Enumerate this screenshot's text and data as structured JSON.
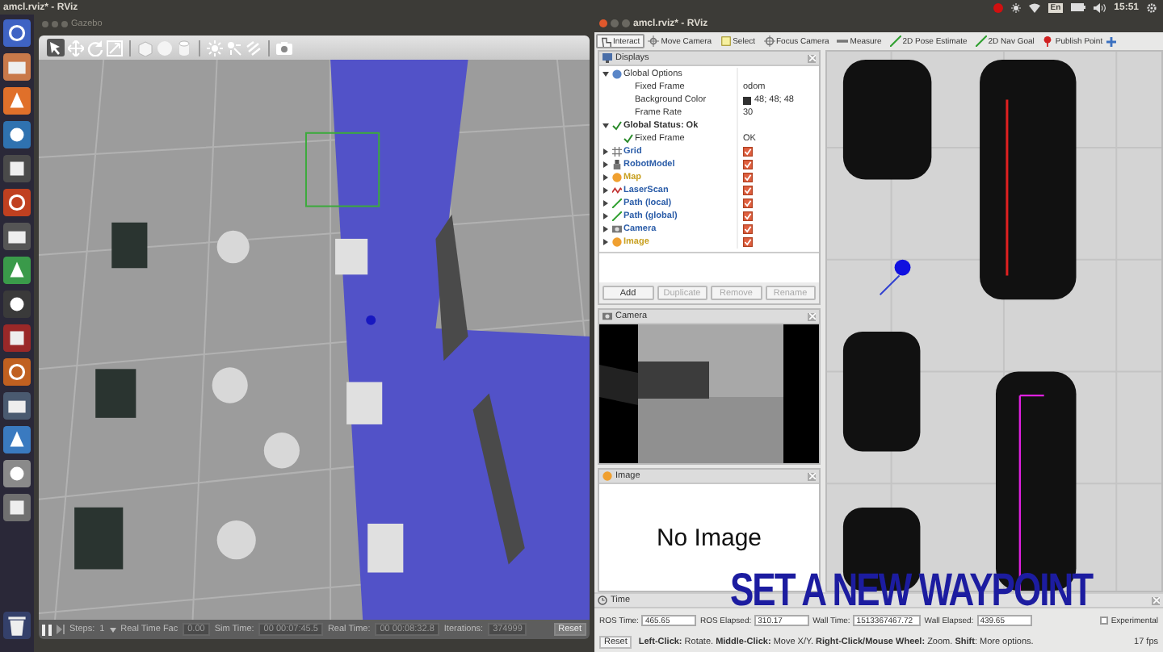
{
  "top_bar": {
    "title": "amcl.rviz* - RViz",
    "keyboard": "En",
    "clock": "15:51"
  },
  "gazebo": {
    "title": "Gazebo",
    "bottom_bar": {
      "steps_label": "Steps:",
      "steps_value": "1",
      "real_time_factor_label": "Real Time Fac",
      "real_time_factor": "0.00",
      "sim_time_label": "Sim Time:",
      "sim_time": "00 00:07:45.5",
      "real_time_label": "Real Time:",
      "real_time": "00 00:08:32.8",
      "iterations_label": "Iterations:",
      "iterations": "374999",
      "reset": "Reset"
    }
  },
  "rviz": {
    "title": "amcl.rviz* - RViz",
    "tools": [
      {
        "label": "Interact",
        "selected": true
      },
      {
        "label": "Move Camera",
        "selected": false
      },
      {
        "label": "Select",
        "selected": false
      },
      {
        "label": "Focus Camera",
        "selected": false
      },
      {
        "label": "Measure",
        "selected": false
      },
      {
        "label": "2D Pose Estimate",
        "selected": false
      },
      {
        "label": "2D Nav Goal",
        "selected": false
      },
      {
        "label": "Publish Point",
        "selected": false
      }
    ],
    "displays": {
      "title": "Displays",
      "items": [
        {
          "kind": "group",
          "name": "Global Options",
          "expanded": true,
          "children": [
            {
              "kind": "property",
              "name": "Fixed Frame",
              "value": "odom"
            },
            {
              "kind": "property",
              "name": "Background Color",
              "value": "48; 48; 48",
              "color": "#303030"
            },
            {
              "kind": "property",
              "name": "Frame Rate",
              "value": "30"
            }
          ]
        },
        {
          "kind": "status",
          "name": "Global Status: Ok",
          "expanded": true,
          "children": [
            {
              "kind": "status",
              "name": "Fixed Frame",
              "value": "OK"
            }
          ]
        },
        {
          "kind": "display",
          "name": "Grid",
          "expanded": false,
          "checked": true,
          "color": "#2a5ca8"
        },
        {
          "kind": "display",
          "name": "RobotModel",
          "expanded": false,
          "checked": true,
          "color": "#2a5ca8"
        },
        {
          "kind": "display",
          "name": "Map",
          "expanded": false,
          "checked": true,
          "color": "#c8a020"
        },
        {
          "kind": "display",
          "name": "LaserScan",
          "expanded": false,
          "checked": true,
          "color": "#2a5ca8"
        },
        {
          "kind": "display",
          "name": "Path (local)",
          "expanded": false,
          "checked": true,
          "color": "#2a5ca8"
        },
        {
          "kind": "display",
          "name": "Path (global)",
          "expanded": false,
          "checked": true,
          "color": "#2a5ca8"
        },
        {
          "kind": "display",
          "name": "Camera",
          "expanded": false,
          "checked": true,
          "color": "#2a5ca8"
        },
        {
          "kind": "display",
          "name": "Image",
          "expanded": false,
          "checked": true,
          "color": "#c8a020"
        }
      ],
      "buttons": [
        {
          "label": "Add",
          "disabled": false
        },
        {
          "label": "Duplicate",
          "disabled": true
        },
        {
          "label": "Remove",
          "disabled": true
        },
        {
          "label": "Rename",
          "disabled": true
        }
      ]
    },
    "camera_panel": {
      "title": "Camera"
    },
    "image_panel": {
      "title": "Image",
      "message": "No Image"
    },
    "time_panel": {
      "title": "Time",
      "fields": [
        {
          "label": "ROS Time:",
          "value": "465.65"
        },
        {
          "label": "ROS Elapsed:",
          "value": "310.17"
        },
        {
          "label": "Wall Time:",
          "value": "1513367467.72"
        },
        {
          "label": "Wall Elapsed:",
          "value": "439.65"
        }
      ],
      "experimental": {
        "label": "Experimental",
        "checked": false
      }
    },
    "status_bar": {
      "reset": "Reset",
      "hint": "**Left-Click:** Rotate. **Middle-Click:** Move X/Y. **Right-Click/Mouse Wheel:** Zoom. **Shift**: More options.",
      "fps": "17 fps"
    }
  },
  "caption": "SET A NEW WAYPOINT"
}
